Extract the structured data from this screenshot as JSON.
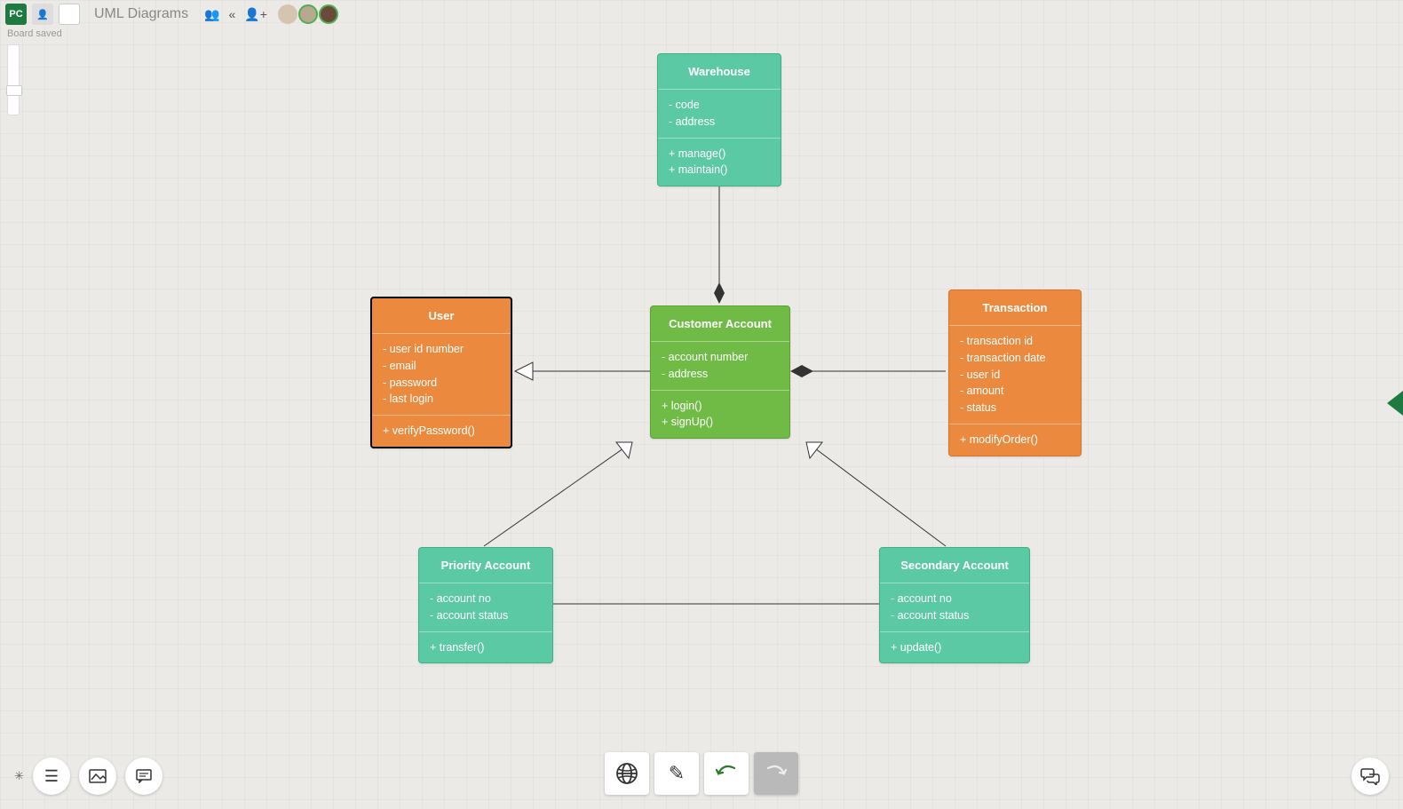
{
  "topbar": {
    "pc_tile": "PC",
    "board_title": "UML Diagrams"
  },
  "status": "Board saved",
  "classes": {
    "warehouse": {
      "title": "Warehouse",
      "attrs": "- code\n- address",
      "ops": "+ manage()\n+ maintain()"
    },
    "user": {
      "title": "User",
      "attrs": "- user id number\n- email\n- password\n- last login",
      "ops": "+ verifyPassword()"
    },
    "customer": {
      "title": "Customer Account",
      "attrs": "- account number\n- address",
      "ops": "+ login()\n+ signUp()"
    },
    "transaction": {
      "title": "Transaction",
      "attrs": "- transaction id\n- transaction date\n- user id\n- amount\n- status",
      "ops": "+ modifyOrder()"
    },
    "priority": {
      "title": "Priority Account",
      "attrs": "- account no\n- account status",
      "ops": "+ transfer()"
    },
    "secondary": {
      "title": "Secondary Account",
      "attrs": "- account no\n- account status",
      "ops": "+ update()"
    }
  }
}
